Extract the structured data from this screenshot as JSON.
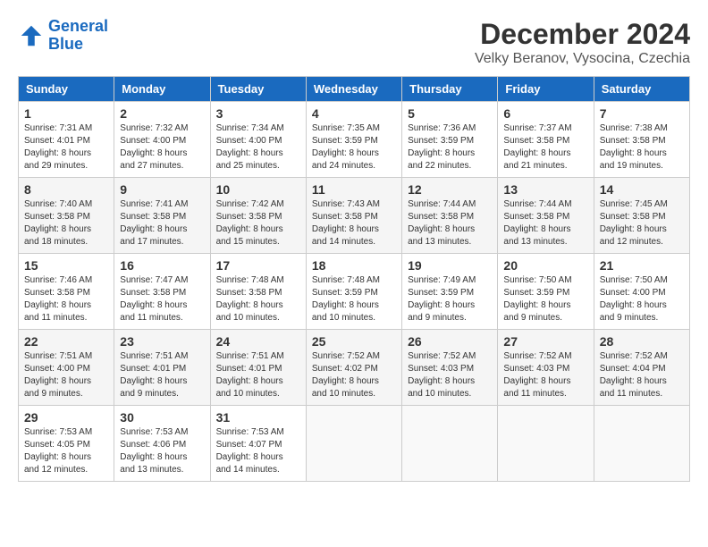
{
  "logo": {
    "line1": "General",
    "line2": "Blue"
  },
  "title": "December 2024",
  "location": "Velky Beranov, Vysocina, Czechia",
  "days_of_week": [
    "Sunday",
    "Monday",
    "Tuesday",
    "Wednesday",
    "Thursday",
    "Friday",
    "Saturday"
  ],
  "weeks": [
    [
      {
        "day": "1",
        "sunrise": "7:31 AM",
        "sunset": "4:01 PM",
        "daylight": "8 hours and 29 minutes."
      },
      {
        "day": "2",
        "sunrise": "7:32 AM",
        "sunset": "4:00 PM",
        "daylight": "8 hours and 27 minutes."
      },
      {
        "day": "3",
        "sunrise": "7:34 AM",
        "sunset": "4:00 PM",
        "daylight": "8 hours and 25 minutes."
      },
      {
        "day": "4",
        "sunrise": "7:35 AM",
        "sunset": "3:59 PM",
        "daylight": "8 hours and 24 minutes."
      },
      {
        "day": "5",
        "sunrise": "7:36 AM",
        "sunset": "3:59 PM",
        "daylight": "8 hours and 22 minutes."
      },
      {
        "day": "6",
        "sunrise": "7:37 AM",
        "sunset": "3:58 PM",
        "daylight": "8 hours and 21 minutes."
      },
      {
        "day": "7",
        "sunrise": "7:38 AM",
        "sunset": "3:58 PM",
        "daylight": "8 hours and 19 minutes."
      }
    ],
    [
      {
        "day": "8",
        "sunrise": "7:40 AM",
        "sunset": "3:58 PM",
        "daylight": "8 hours and 18 minutes."
      },
      {
        "day": "9",
        "sunrise": "7:41 AM",
        "sunset": "3:58 PM",
        "daylight": "8 hours and 17 minutes."
      },
      {
        "day": "10",
        "sunrise": "7:42 AM",
        "sunset": "3:58 PM",
        "daylight": "8 hours and 15 minutes."
      },
      {
        "day": "11",
        "sunrise": "7:43 AM",
        "sunset": "3:58 PM",
        "daylight": "8 hours and 14 minutes."
      },
      {
        "day": "12",
        "sunrise": "7:44 AM",
        "sunset": "3:58 PM",
        "daylight": "8 hours and 13 minutes."
      },
      {
        "day": "13",
        "sunrise": "7:44 AM",
        "sunset": "3:58 PM",
        "daylight": "8 hours and 13 minutes."
      },
      {
        "day": "14",
        "sunrise": "7:45 AM",
        "sunset": "3:58 PM",
        "daylight": "8 hours and 12 minutes."
      }
    ],
    [
      {
        "day": "15",
        "sunrise": "7:46 AM",
        "sunset": "3:58 PM",
        "daylight": "8 hours and 11 minutes."
      },
      {
        "day": "16",
        "sunrise": "7:47 AM",
        "sunset": "3:58 PM",
        "daylight": "8 hours and 11 minutes."
      },
      {
        "day": "17",
        "sunrise": "7:48 AM",
        "sunset": "3:58 PM",
        "daylight": "8 hours and 10 minutes."
      },
      {
        "day": "18",
        "sunrise": "7:48 AM",
        "sunset": "3:59 PM",
        "daylight": "8 hours and 10 minutes."
      },
      {
        "day": "19",
        "sunrise": "7:49 AM",
        "sunset": "3:59 PM",
        "daylight": "8 hours and 9 minutes."
      },
      {
        "day": "20",
        "sunrise": "7:50 AM",
        "sunset": "3:59 PM",
        "daylight": "8 hours and 9 minutes."
      },
      {
        "day": "21",
        "sunrise": "7:50 AM",
        "sunset": "4:00 PM",
        "daylight": "8 hours and 9 minutes."
      }
    ],
    [
      {
        "day": "22",
        "sunrise": "7:51 AM",
        "sunset": "4:00 PM",
        "daylight": "8 hours and 9 minutes."
      },
      {
        "day": "23",
        "sunrise": "7:51 AM",
        "sunset": "4:01 PM",
        "daylight": "8 hours and 9 minutes."
      },
      {
        "day": "24",
        "sunrise": "7:51 AM",
        "sunset": "4:01 PM",
        "daylight": "8 hours and 10 minutes."
      },
      {
        "day": "25",
        "sunrise": "7:52 AM",
        "sunset": "4:02 PM",
        "daylight": "8 hours and 10 minutes."
      },
      {
        "day": "26",
        "sunrise": "7:52 AM",
        "sunset": "4:03 PM",
        "daylight": "8 hours and 10 minutes."
      },
      {
        "day": "27",
        "sunrise": "7:52 AM",
        "sunset": "4:03 PM",
        "daylight": "8 hours and 11 minutes."
      },
      {
        "day": "28",
        "sunrise": "7:52 AM",
        "sunset": "4:04 PM",
        "daylight": "8 hours and 11 minutes."
      }
    ],
    [
      {
        "day": "29",
        "sunrise": "7:53 AM",
        "sunset": "4:05 PM",
        "daylight": "8 hours and 12 minutes."
      },
      {
        "day": "30",
        "sunrise": "7:53 AM",
        "sunset": "4:06 PM",
        "daylight": "8 hours and 13 minutes."
      },
      {
        "day": "31",
        "sunrise": "7:53 AM",
        "sunset": "4:07 PM",
        "daylight": "8 hours and 14 minutes."
      },
      null,
      null,
      null,
      null
    ]
  ]
}
